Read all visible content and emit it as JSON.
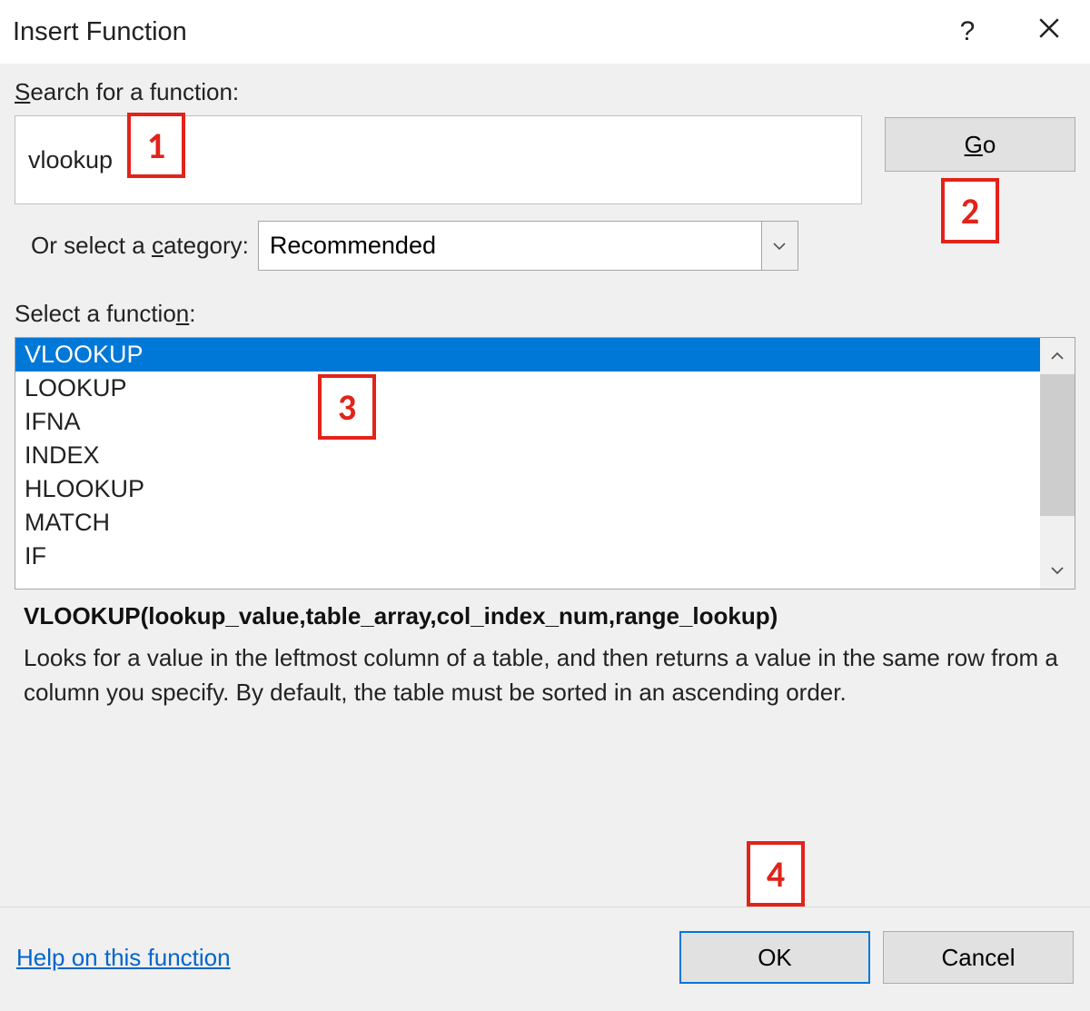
{
  "titlebar": {
    "title": "Insert Function",
    "help": "?",
    "close": "×"
  },
  "search": {
    "label_pre": "S",
    "label_post": "earch for a function:",
    "value": "vlookup",
    "go_pre": "G",
    "go_post": "o"
  },
  "category": {
    "label_pre": "Or select a ",
    "label_under": "c",
    "label_post": "ategory:",
    "selected": "Recommended"
  },
  "select_function": {
    "label_pre": "Select a functio",
    "label_under": "n",
    "label_post": ":",
    "items": [
      "VLOOKUP",
      "LOOKUP",
      "IFNA",
      "INDEX",
      "HLOOKUP",
      "MATCH",
      "IF"
    ],
    "selected_index": 0
  },
  "details": {
    "signature": "VLOOKUP(lookup_value,table_array,col_index_num,range_lookup)",
    "description": "Looks for a value in the leftmost column of a table, and then returns a value in the same row from a column you specify. By default, the table must be sorted in an ascending order."
  },
  "footer": {
    "help_link": "Help on this function",
    "ok": "OK",
    "cancel": "Cancel"
  },
  "callouts": {
    "c1": "1",
    "c2": "2",
    "c3": "3",
    "c4": "4"
  }
}
